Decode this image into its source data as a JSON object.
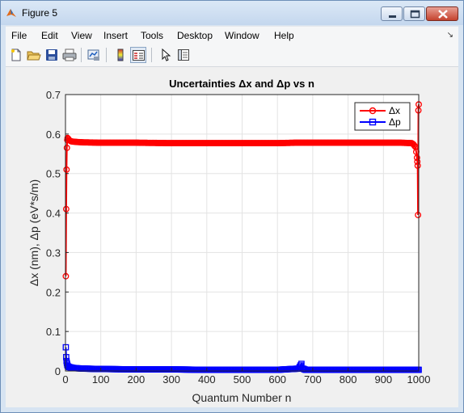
{
  "window": {
    "title": "Figure 5",
    "minimize_label": "minimize",
    "maximize_label": "maximize",
    "close_label": "close"
  },
  "menu": {
    "items": [
      "File",
      "Edit",
      "View",
      "Insert",
      "Tools",
      "Desktop",
      "Window",
      "Help"
    ]
  },
  "toolbar": {
    "icons": [
      "new-figure-icon",
      "open-file-icon",
      "save-icon",
      "print-icon",
      "link-plot-icon",
      "colorbar-icon",
      "legend-icon",
      "pointer-icon",
      "property-editor-icon"
    ]
  },
  "chart_data": {
    "type": "line",
    "title": "Uncertainties Δx and Δp vs n",
    "xlabel": "Quantum Number n",
    "ylabel": "Δx (nm), Δp (eV*s/m)",
    "xlim": [
      0,
      1000
    ],
    "ylim": [
      0,
      0.7
    ],
    "xticks": [
      "0",
      "100",
      "200",
      "300",
      "400",
      "500",
      "600",
      "700",
      "800",
      "900",
      "1000"
    ],
    "yticks": [
      "0",
      "0.1",
      "0.2",
      "0.3",
      "0.4",
      "0.5",
      "0.6",
      "0.7"
    ],
    "grid": true,
    "legend_location": "top-right",
    "series": [
      {
        "name": "Δx",
        "color": "#ff0000",
        "marker": "circle",
        "x": [
          1,
          2,
          3,
          4,
          5,
          6,
          8,
          10,
          15,
          20,
          30,
          50,
          100,
          200,
          300,
          400,
          500,
          600,
          650,
          700,
          800,
          900,
          950,
          980,
          985,
          990,
          993,
          995,
          996,
          997,
          998,
          999,
          1000
        ],
        "y": [
          0.24,
          0.41,
          0.51,
          0.565,
          0.585,
          0.59,
          0.588,
          0.585,
          0.582,
          0.581,
          0.58,
          0.579,
          0.578,
          0.578,
          0.577,
          0.577,
          0.577,
          0.577,
          0.578,
          0.578,
          0.578,
          0.578,
          0.578,
          0.577,
          0.574,
          0.568,
          0.555,
          0.54,
          0.53,
          0.52,
          0.395,
          0.66,
          0.675
        ]
      },
      {
        "name": "Δp",
        "color": "#0000ff",
        "marker": "square",
        "x": [
          1,
          2,
          3,
          4,
          5,
          6,
          8,
          10,
          15,
          20,
          30,
          50,
          100,
          200,
          300,
          400,
          500,
          600,
          660,
          668,
          672,
          680,
          700,
          800,
          900,
          1000
        ],
        "y": [
          0.06,
          0.035,
          0.025,
          0.02,
          0.016,
          0.013,
          0.011,
          0.01,
          0.009,
          0.008,
          0.007,
          0.006,
          0.005,
          0.004,
          0.004,
          0.003,
          0.003,
          0.003,
          0.006,
          0.018,
          0.006,
          0.003,
          0.003,
          0.003,
          0.003,
          0.003
        ]
      }
    ]
  }
}
